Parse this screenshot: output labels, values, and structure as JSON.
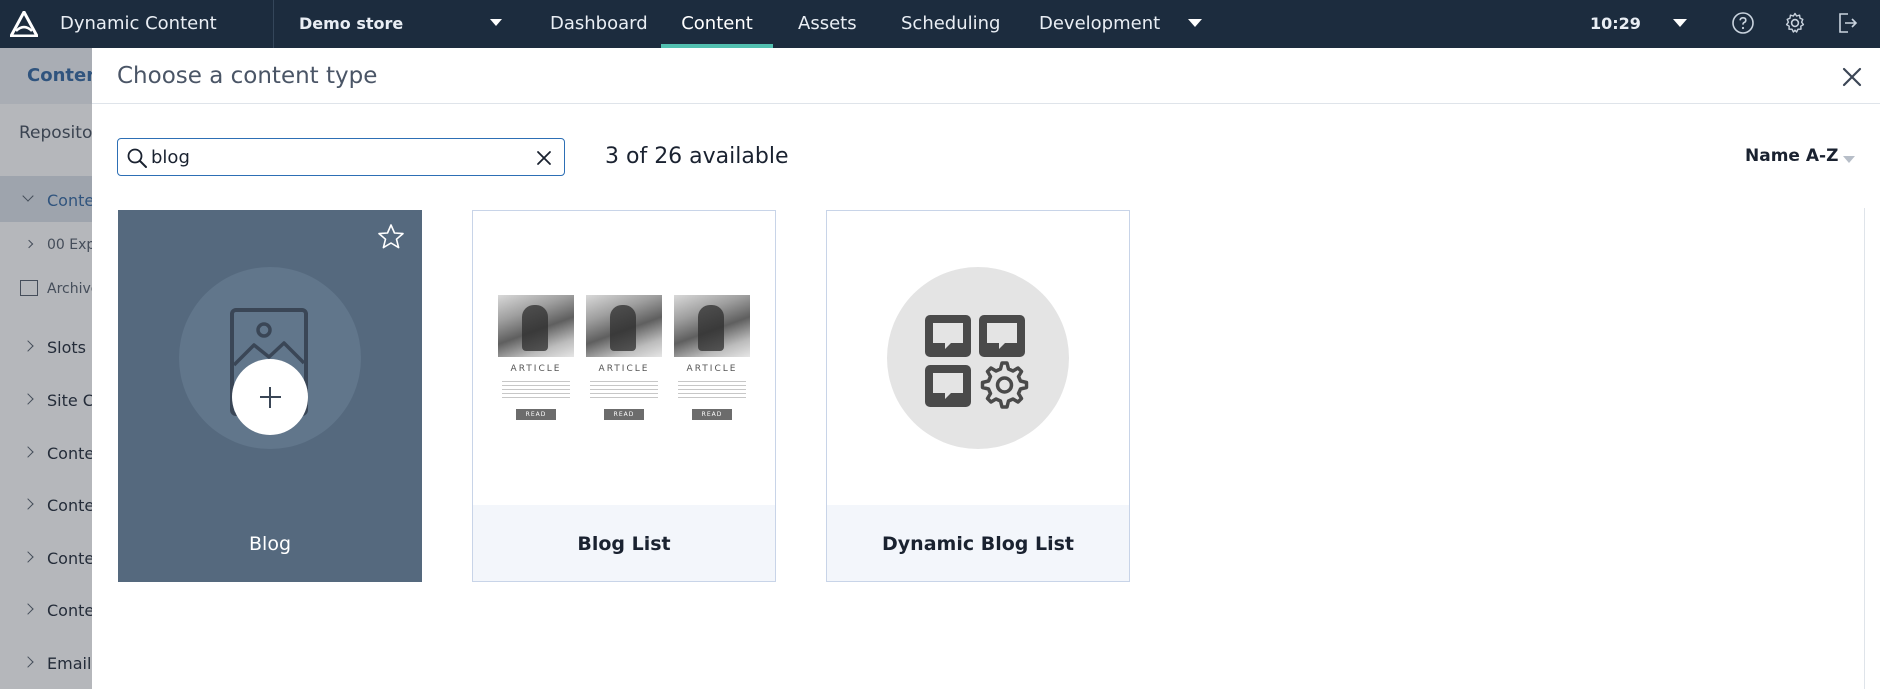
{
  "topbar": {
    "app_title": "Dynamic Content",
    "store": "Demo store",
    "tabs": [
      {
        "label": "Dashboard",
        "active": false
      },
      {
        "label": "Content",
        "active": true
      },
      {
        "label": "Assets",
        "active": false
      },
      {
        "label": "Scheduling",
        "active": false
      },
      {
        "label": "Development",
        "active": false
      }
    ],
    "time": "10:29",
    "icons": [
      "help-icon",
      "gear-icon",
      "logout-icon"
    ]
  },
  "background_panel": {
    "header": "Content",
    "repository": "Repositor",
    "items": [
      "Conte",
      "00 Exp",
      "Archive",
      "Slots",
      "Site Co",
      "Conte",
      "Conte",
      "Conte",
      "Conte",
      "Email"
    ]
  },
  "modal": {
    "title": "Choose a content type",
    "search": {
      "value": "blog",
      "placeholder": ""
    },
    "count": "3 of 26 available",
    "sort": "Name A-Z",
    "cards": [
      {
        "label": "Blog",
        "selected": true
      },
      {
        "label": "Blog List",
        "selected": false,
        "thumb_text": "ARTICLE",
        "read_text": "READ"
      },
      {
        "label": "Dynamic Blog List",
        "selected": false
      }
    ]
  },
  "colors": {
    "topbar": "#1c2c3e",
    "active_tab_underline": "#52c0b0",
    "selected_card": "#55697e",
    "search_border": "#2d6fb5"
  }
}
